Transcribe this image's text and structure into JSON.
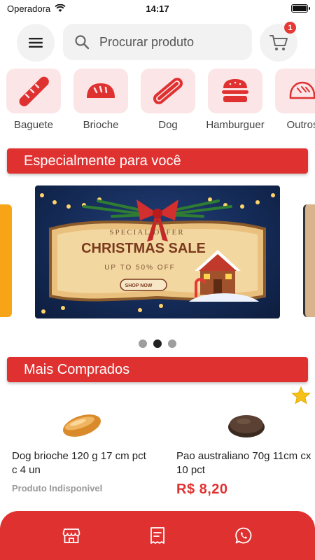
{
  "status_bar": {
    "carrier": "Operadora",
    "time": "14:17"
  },
  "header": {
    "search_placeholder": "Procurar produto",
    "cart_count": "1"
  },
  "categories": [
    {
      "label": "Baguete",
      "icon": "baguette-icon"
    },
    {
      "label": "Brioche",
      "icon": "brioche-icon"
    },
    {
      "label": "Dog",
      "icon": "hotdog-icon"
    },
    {
      "label": "Hamburguer",
      "icon": "hamburger-icon"
    },
    {
      "label": "Outros",
      "icon": "bread-icon"
    }
  ],
  "sections": {
    "special": "Especialmente para você",
    "top": "Mais Comprados"
  },
  "banner": {
    "line1": "SPECIAL OFFER",
    "line2": "CHRISTMAS SALE",
    "line3": "UP TO 50% OFF",
    "cta": "SHOP NOW"
  },
  "carousel": {
    "pages": 3,
    "active": 2
  },
  "products": [
    {
      "name": "Dog brioche 120 g  17 cm pct c 4 un",
      "status": "Produto Indisponivel"
    },
    {
      "name": "Pao australiano 70g 11cm cx 10 pct",
      "price": "R$ 8,20"
    }
  ],
  "colors": {
    "primary": "#e03131",
    "category_bg": "#fbe5e7",
    "star": "#f6c21a"
  }
}
